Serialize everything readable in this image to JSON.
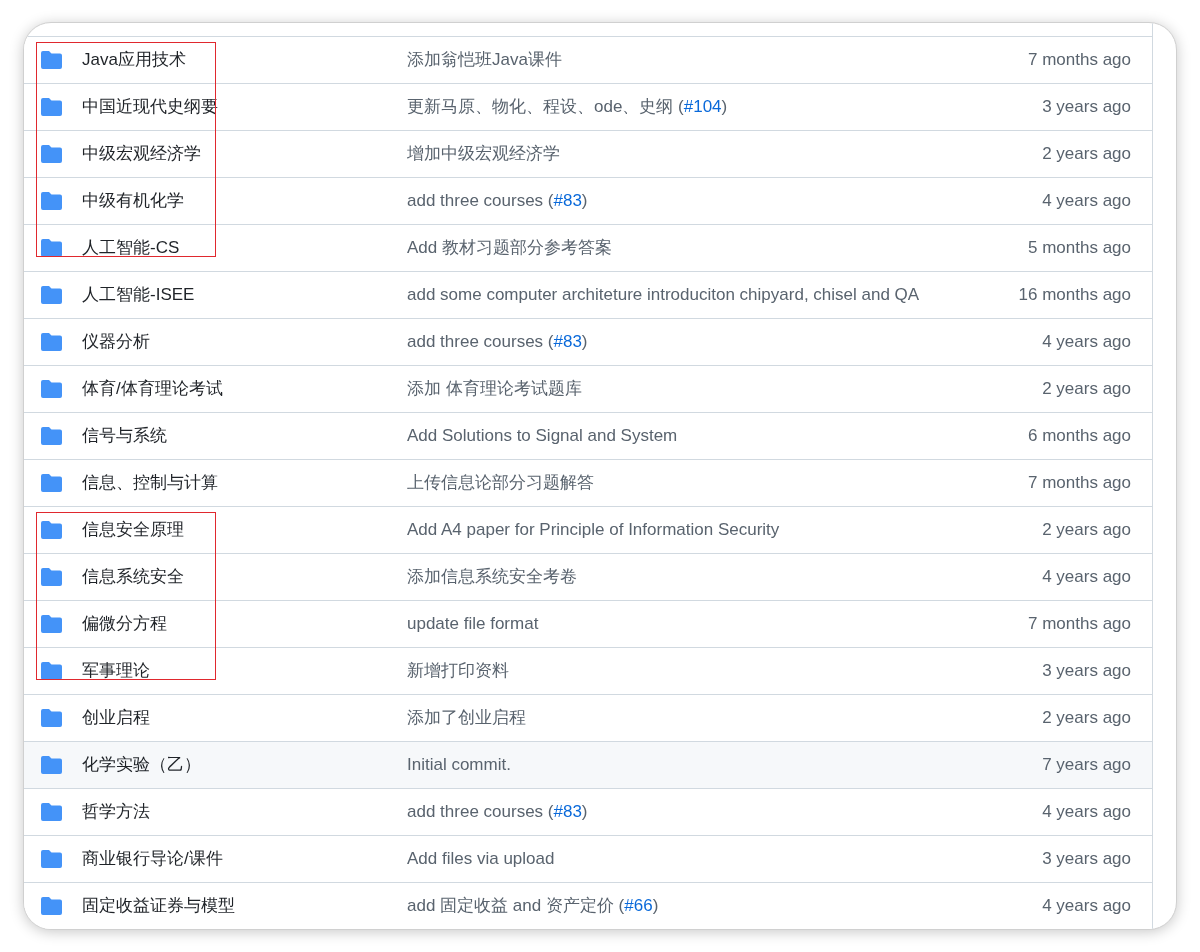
{
  "rows": [
    {
      "name": "Java应用技术",
      "message": [
        {
          "kind": "text",
          "text": "添加翁恺班Java课件"
        }
      ],
      "time": "7 months ago",
      "boxed": true,
      "hovered": false
    },
    {
      "name": "中国近现代史纲要",
      "message": [
        {
          "kind": "text",
          "text": "更新马原、物化、程设、ode、史纲 ("
        },
        {
          "kind": "link",
          "text": "#104"
        },
        {
          "kind": "text",
          "text": ")"
        }
      ],
      "time": "3 years ago",
      "boxed": true,
      "hovered": false
    },
    {
      "name": "中级宏观经济学",
      "message": [
        {
          "kind": "text",
          "text": "增加中级宏观经济学"
        }
      ],
      "time": "2 years ago",
      "boxed": true,
      "hovered": false
    },
    {
      "name": "中级有机化学",
      "message": [
        {
          "kind": "text",
          "text": "add three courses ("
        },
        {
          "kind": "link",
          "text": "#83"
        },
        {
          "kind": "text",
          "text": ")"
        }
      ],
      "time": "4 years ago",
      "boxed": true,
      "hovered": false
    },
    {
      "name": "人工智能-CS",
      "message": [
        {
          "kind": "text",
          "text": "Add 教材习题部分参考答案"
        }
      ],
      "time": "5 months ago",
      "boxed": true,
      "hovered": false
    },
    {
      "name": "人工智能-ISEE",
      "message": [
        {
          "kind": "text",
          "text": "add some computer architeture introduciton chipyard, chisel and QA"
        }
      ],
      "time": "16 months ago",
      "boxed": false,
      "hovered": false
    },
    {
      "name": "仪器分析",
      "message": [
        {
          "kind": "text",
          "text": "add three courses ("
        },
        {
          "kind": "link",
          "text": "#83"
        },
        {
          "kind": "text",
          "text": ")"
        }
      ],
      "time": "4 years ago",
      "boxed": false,
      "hovered": false
    },
    {
      "name": "体育/体育理论考试",
      "message": [
        {
          "kind": "text",
          "text": "添加 体育理论考试题库"
        }
      ],
      "time": "2 years ago",
      "boxed": false,
      "hovered": false
    },
    {
      "name": "信号与系统",
      "message": [
        {
          "kind": "text",
          "text": "Add Solutions to Signal and System"
        }
      ],
      "time": "6 months ago",
      "boxed": false,
      "hovered": false
    },
    {
      "name": "信息、控制与计算",
      "message": [
        {
          "kind": "text",
          "text": "上传信息论部分习题解答"
        }
      ],
      "time": "7 months ago",
      "boxed": false,
      "hovered": false
    },
    {
      "name": "信息安全原理",
      "message": [
        {
          "kind": "text",
          "text": "Add A4 paper for Principle of Information Security"
        }
      ],
      "time": "2 years ago",
      "boxed": true,
      "hovered": false
    },
    {
      "name": "信息系统安全",
      "message": [
        {
          "kind": "text",
          "text": "添加信息系统安全考卷"
        }
      ],
      "time": "4 years ago",
      "boxed": true,
      "hovered": false
    },
    {
      "name": "偏微分方程",
      "message": [
        {
          "kind": "text",
          "text": "update file format"
        }
      ],
      "time": "7 months ago",
      "boxed": true,
      "hovered": false
    },
    {
      "name": "军事理论",
      "message": [
        {
          "kind": "text",
          "text": "新增打印资料"
        }
      ],
      "time": "3 years ago",
      "boxed": true,
      "hovered": false
    },
    {
      "name": "创业启程",
      "message": [
        {
          "kind": "text",
          "text": "添加了创业启程"
        }
      ],
      "time": "2 years ago",
      "boxed": false,
      "hovered": false
    },
    {
      "name": "化学实验（乙）",
      "message": [
        {
          "kind": "text",
          "text": "Initial commit."
        }
      ],
      "time": "7 years ago",
      "boxed": false,
      "hovered": true
    },
    {
      "name": "哲学方法",
      "message": [
        {
          "kind": "text",
          "text": "add three courses ("
        },
        {
          "kind": "link",
          "text": "#83"
        },
        {
          "kind": "text",
          "text": ")"
        }
      ],
      "time": "4 years ago",
      "boxed": false,
      "hovered": false
    },
    {
      "name": "商业银行导论/课件",
      "message": [
        {
          "kind": "text",
          "text": "Add files via upload"
        }
      ],
      "time": "3 years ago",
      "boxed": false,
      "hovered": false
    },
    {
      "name": "固定收益证券与模型",
      "message": [
        {
          "kind": "text",
          "text": "add 固定收益 and 资产定价 ("
        },
        {
          "kind": "link",
          "text": "#66"
        },
        {
          "kind": "text",
          "text": ")"
        }
      ],
      "time": "4 years ago",
      "boxed": false,
      "hovered": false
    }
  ]
}
